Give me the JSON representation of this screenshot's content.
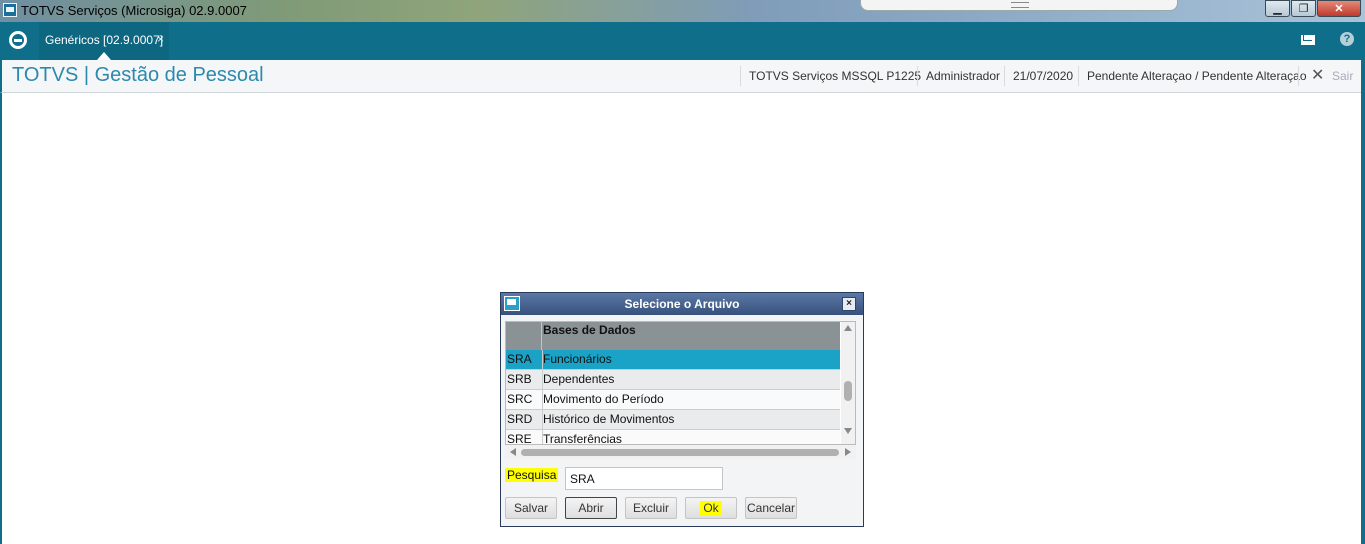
{
  "window": {
    "title": "TOTVS Serviços (Microsiga) 02.9.0007",
    "min_glyph": "▁",
    "max_glyph": "❐",
    "close_glyph": "✕"
  },
  "tabs": [
    {
      "label": "Genéricos [02.9.0007]",
      "close_glyph": "×"
    }
  ],
  "toolbar_icons": {
    "home": "home-icon",
    "mail": "mail-icon",
    "help": "help-icon",
    "help_glyph": "?"
  },
  "header": {
    "module_title": "TOTVS | Gestão de Pessoal",
    "environment": "TOTVS Serviços MSSQL P1225",
    "user": "Administrador",
    "date": "21/07/2020",
    "status": "Pendente Alteraçao / Pendente Alteraçao",
    "exit_glyph": "✕",
    "exit_label": "Sair"
  },
  "dialog": {
    "title": "Selecione o Arquivo",
    "close_glyph": "×",
    "grid": {
      "column_header": "Bases de Dados",
      "rows": [
        {
          "code": "SRA",
          "name": "Funcionários",
          "selected": true
        },
        {
          "code": "SRB",
          "name": "Dependentes"
        },
        {
          "code": "SRC",
          "name": "Movimento do Período"
        },
        {
          "code": "SRD",
          "name": "Histórico de Movimentos"
        },
        {
          "code": "SRE",
          "name": "Transferências"
        }
      ]
    },
    "search": {
      "label": "Pesquisa",
      "value": "SRA"
    },
    "buttons": {
      "salvar": "Salvar",
      "abrir": "Abrir",
      "excluir": "Excluir",
      "ok": "Ok",
      "cancelar": "Cancelar"
    }
  },
  "colors": {
    "app_bar": "#0f6f8a",
    "module_title": "#2b89ad",
    "selected_row": "#1aa3c6",
    "highlight": "#ffff00"
  }
}
